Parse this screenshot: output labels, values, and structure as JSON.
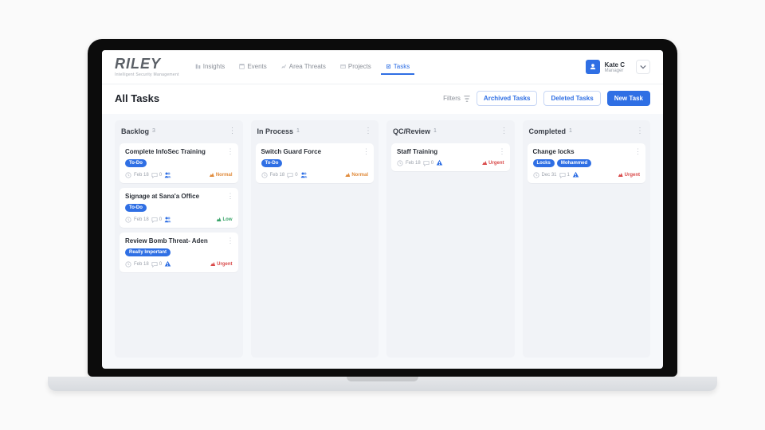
{
  "brand": {
    "name": "RILEY",
    "tagline": "Intelligent Security Management"
  },
  "nav": {
    "items": [
      {
        "label": "Insights"
      },
      {
        "label": "Events"
      },
      {
        "label": "Area Threats"
      },
      {
        "label": "Projects"
      },
      {
        "label": "Tasks"
      }
    ],
    "active_index": 4
  },
  "user": {
    "name": "Kate C",
    "role": "Manager"
  },
  "page": {
    "title": "All Tasks"
  },
  "toolbar": {
    "filters_label": "Filters",
    "archived_label": "Archived Tasks",
    "deleted_label": "Deleted Tasks",
    "new_label": "New Task"
  },
  "columns": [
    {
      "title": "Backlog",
      "count": "3",
      "cards": [
        {
          "title": "Complete InfoSec Training",
          "tags": [
            {
              "text": "To-Do",
              "kind": "todo"
            }
          ],
          "date": "Feb 18",
          "comments": "0",
          "badge": "users",
          "priority": "Normal",
          "priority_kind": "normal"
        },
        {
          "title": "Signage at Sana'a Office",
          "tags": [
            {
              "text": "To-Do",
              "kind": "todo"
            }
          ],
          "date": "Feb 18",
          "comments": "0",
          "badge": "users",
          "priority": "Low",
          "priority_kind": "low"
        },
        {
          "title": "Review Bomb Threat- Aden",
          "tags": [
            {
              "text": "Really Important",
              "kind": "imp"
            }
          ],
          "date": "Feb 18",
          "comments": "0",
          "badge": "alert",
          "priority": "Urgent",
          "priority_kind": "urgent"
        }
      ]
    },
    {
      "title": "In Process",
      "count": "1",
      "cards": [
        {
          "title": "Switch Guard Force",
          "tags": [
            {
              "text": "To-Do",
              "kind": "todo"
            }
          ],
          "date": "Feb 18",
          "comments": "0",
          "badge": "users",
          "priority": "Normal",
          "priority_kind": "normal"
        }
      ]
    },
    {
      "title": "QC/Review",
      "count": "1",
      "cards": [
        {
          "title": "Staff Training",
          "tags": [],
          "date": "Feb 18",
          "comments": "0",
          "badge": "alert",
          "priority": "Urgent",
          "priority_kind": "urgent"
        }
      ]
    },
    {
      "title": "Completed",
      "count": "1",
      "cards": [
        {
          "title": "Change locks",
          "tags": [
            {
              "text": "Locks",
              "kind": "locks"
            },
            {
              "text": "Mohammed",
              "kind": "person"
            }
          ],
          "date": "Dec 31",
          "comments": "1",
          "badge": "alert",
          "priority": "Urgent",
          "priority_kind": "urgent"
        }
      ]
    }
  ]
}
